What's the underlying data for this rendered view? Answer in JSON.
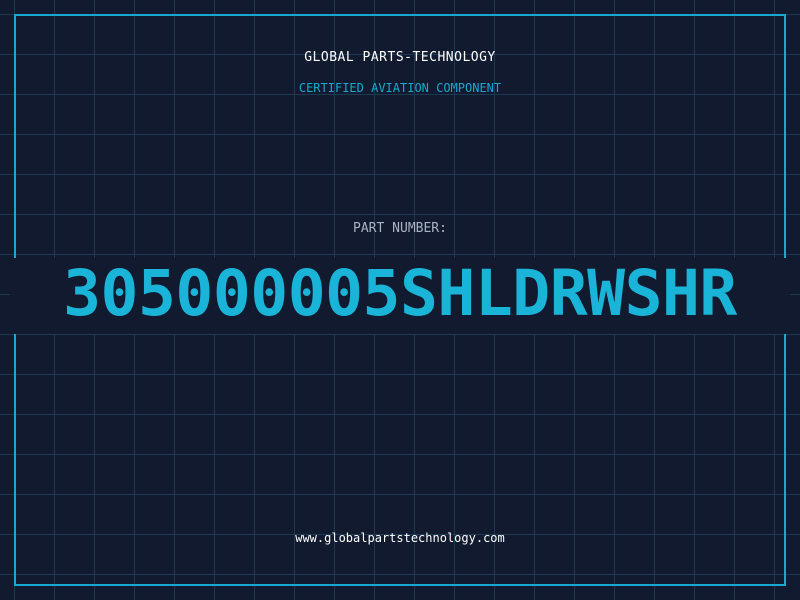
{
  "header": {
    "brand": "GLOBAL PARTS-TECHNOLOGY",
    "subtitle": "CERTIFIED AVIATION COMPONENT"
  },
  "part": {
    "label": "PART NUMBER:",
    "number": "305000005SHLDRWSHR"
  },
  "footer": {
    "url": "www.globalpartstechnology.com"
  },
  "colors": {
    "background": "#111a2e",
    "grid": "#1d3a55",
    "accent": "#19b4d8",
    "frame": "#19a9d0"
  }
}
